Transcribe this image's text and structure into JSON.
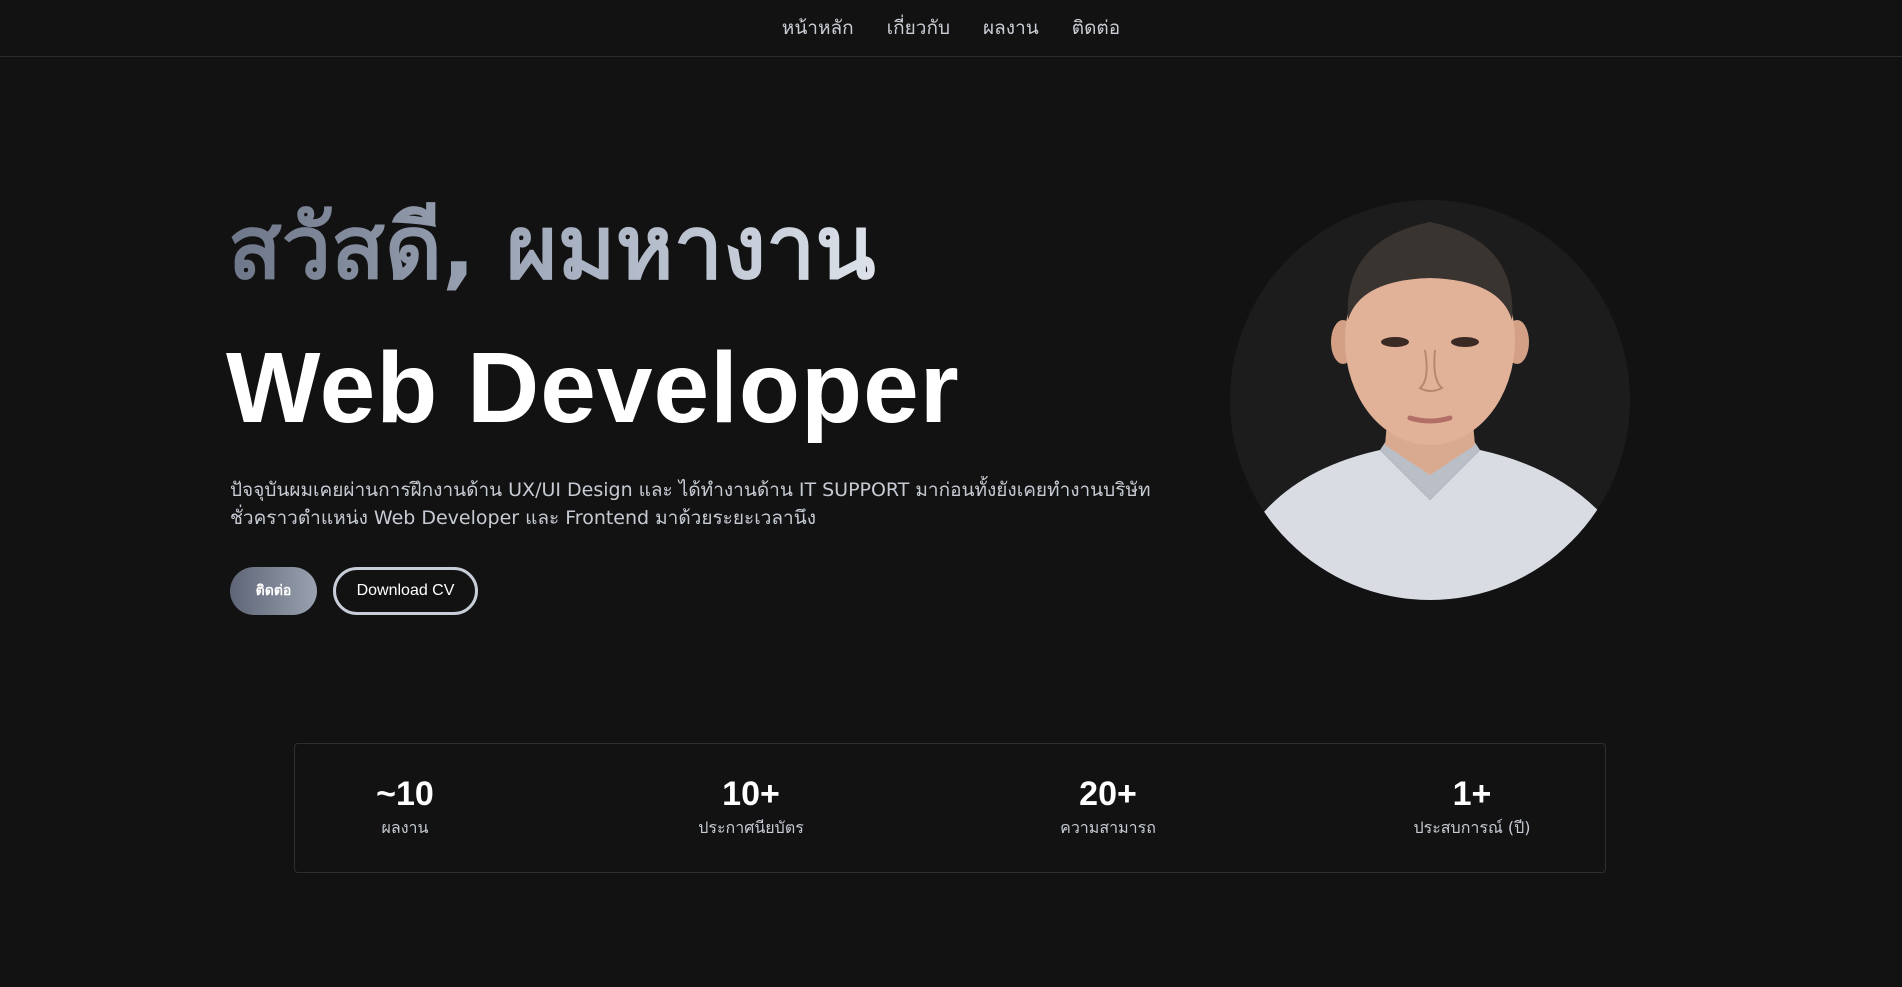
{
  "nav": {
    "items": [
      {
        "label": "หน้าหลัก"
      },
      {
        "label": "เกี่ยวกับ"
      },
      {
        "label": "ผลงาน"
      },
      {
        "label": "ติดต่อ"
      }
    ]
  },
  "hero": {
    "greeting": "สวัสดี, ผมหางาน",
    "role": "Web Developer",
    "description": "ปัจจุบันผมเคยผ่านการฝึกงานด้าน UX/UI Design และ ได้ทำงานด้าน IT SUPPORT มาก่อนทั้งยังเคยทำงานบริษัท ชั่วคราวตำแหน่ง Web Developer และ Frontend มาด้วยระยะเวลานึง",
    "contact_button": "ติดต่อ",
    "cv_button": "Download CV"
  },
  "stats": [
    {
      "value": "~10",
      "label": "ผลงาน"
    },
    {
      "value": "10+",
      "label": "ประกาศนียบัตร"
    },
    {
      "value": "20+",
      "label": "ความสามารถ"
    },
    {
      "value": "1+",
      "label": "ประสบการณ์ (ปี)"
    }
  ],
  "colors": {
    "background": "#121212",
    "text_primary": "#ffffff",
    "text_muted": "#c6cbd3",
    "accent_gradient_start": "#5e6576",
    "accent_gradient_end": "#9aa2b1"
  }
}
